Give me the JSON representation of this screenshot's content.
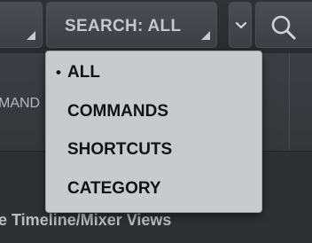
{
  "toolbar": {
    "search_filter": {
      "label": "SEARCH: ALL"
    },
    "icons": {
      "chevron": "chevron-down-icon",
      "search": "magnifier-icon",
      "corner": "corner-triangle-icon"
    }
  },
  "header": {
    "left_label": "MAND"
  },
  "content": {
    "lower_text": "e Timeline/Mixer Views"
  },
  "menu": {
    "selected_marker": "•",
    "items": [
      {
        "label": "ALL",
        "selected": true
      },
      {
        "label": "COMMANDS",
        "selected": false
      },
      {
        "label": "SHORTCUTS",
        "selected": false
      },
      {
        "label": "CATEGORY",
        "selected": false
      }
    ]
  },
  "colors": {
    "toolbar_bg": "#303336",
    "button_bg": "#44484c",
    "menu_bg": "#c8cbce",
    "menu_text": "#111315",
    "label_text": "#c4c7cb"
  }
}
